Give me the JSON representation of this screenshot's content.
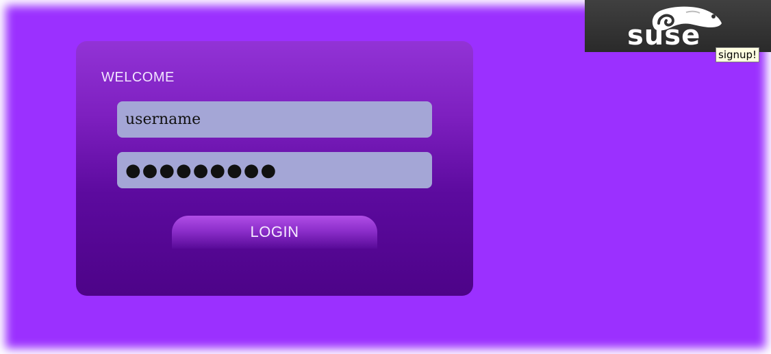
{
  "login": {
    "welcome_text": "WELCOME",
    "username_value": "username",
    "password_value": "●●●●●●●●●",
    "login_label": "LOGIN"
  },
  "brand": {
    "logo_text": "suse",
    "icon": "chameleon-icon"
  },
  "signup": {
    "label": "signup!"
  },
  "colors": {
    "background": "#9b30ff",
    "panel_top": "#9233d6",
    "panel_bottom": "#4d0388",
    "field": "#a4a6d6"
  }
}
